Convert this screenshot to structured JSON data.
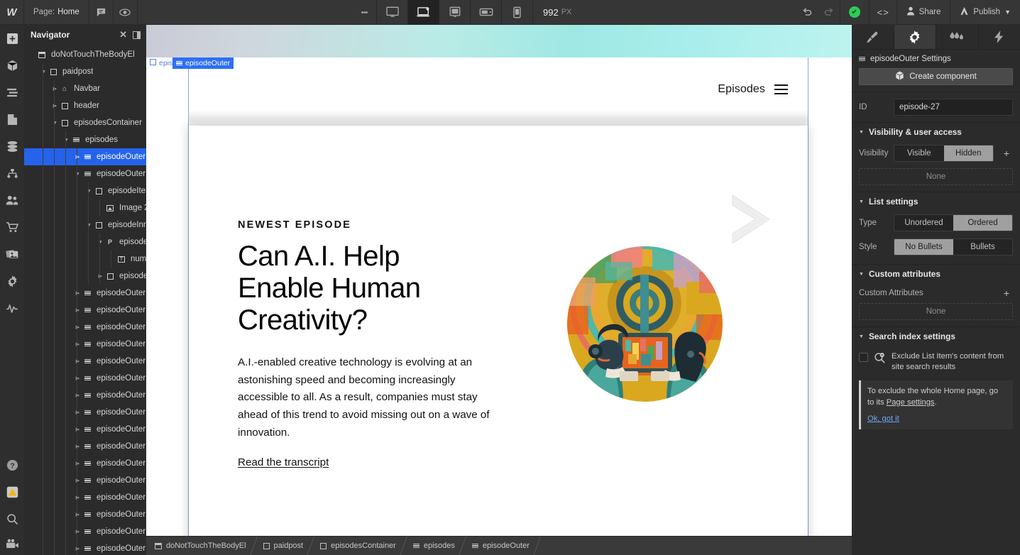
{
  "topbar": {
    "logo": "W",
    "page_label": "Page:",
    "page_name": "Home",
    "comment_icon": "comment-icon",
    "preview_icon": "eye-icon",
    "more_icon": "kebab-menu-icon",
    "devices": [
      {
        "name": "desktop-breakpoint",
        "icon": "monitor-icon",
        "active": false
      },
      {
        "name": "base-breakpoint",
        "icon": "laptop-star-icon",
        "active": true
      },
      {
        "name": "tablet-breakpoint",
        "icon": "tablet-icon",
        "active": false
      },
      {
        "name": "mobile-landscape-breakpoint",
        "icon": "mobile-landscape-icon",
        "active": false
      },
      {
        "name": "mobile-portrait-breakpoint",
        "icon": "mobile-icon",
        "active": false
      }
    ],
    "viewport_width": "992",
    "viewport_unit": "PX",
    "undo_icon": "undo-arrow-icon",
    "redo_icon": "redo-arrow-icon",
    "status_icon": "checkmark-icon",
    "status_color": "#2fcc56",
    "code_icon": "code-brackets-icon",
    "share_label": "Share",
    "share_icon": "person-icon",
    "publish_label": "Publish",
    "publish_icon": "rocket-icon",
    "publish_caret": "chevron-down-icon"
  },
  "rail": {
    "items": [
      {
        "name": "add-elements",
        "icon": "plus-square-icon"
      },
      {
        "name": "components",
        "icon": "cube-icon"
      },
      {
        "name": "style-manager",
        "icon": "sliders-icon"
      },
      {
        "name": "pages",
        "icon": "page-icon"
      },
      {
        "name": "cms",
        "icon": "database-icon"
      },
      {
        "name": "site-structure",
        "icon": "sitemap-icon"
      },
      {
        "name": "users",
        "icon": "users-icon"
      },
      {
        "name": "ecommerce",
        "icon": "cart-icon"
      },
      {
        "name": "assets",
        "icon": "images-icon"
      },
      {
        "name": "settings",
        "icon": "gear-icon"
      },
      {
        "name": "audit",
        "icon": "pulse-icon"
      }
    ],
    "bottom": [
      {
        "name": "help",
        "icon": "question-circle-icon"
      },
      {
        "name": "alerts",
        "icon": "warning-triangle-icon"
      },
      {
        "name": "search",
        "icon": "search-icon"
      },
      {
        "name": "video",
        "icon": "video-camera-icon"
      }
    ]
  },
  "navigator": {
    "title": "Navigator",
    "close_icon": "close-icon",
    "collapse_icon": "panel-toggle-icon",
    "tree": [
      {
        "label": "doNotTouchTheBodyEl",
        "depth": 0,
        "icon": "body-icon",
        "caret": "",
        "selected": false
      },
      {
        "label": "paidpost",
        "depth": 1,
        "icon": "div-icon",
        "caret": "down",
        "selected": false
      },
      {
        "label": "Navbar",
        "depth": 2,
        "icon": "navbar-icon",
        "caret": "right",
        "selected": false
      },
      {
        "label": "header",
        "depth": 2,
        "icon": "div-icon",
        "caret": "right",
        "selected": false
      },
      {
        "label": "episodesContainer",
        "depth": 2,
        "icon": "div-icon",
        "caret": "down",
        "selected": false
      },
      {
        "label": "episodes",
        "depth": 3,
        "icon": "list-icon",
        "caret": "down",
        "selected": false
      },
      {
        "label": "episodeOuter",
        "depth": 4,
        "icon": "list-item-icon",
        "caret": "right",
        "selected": true
      },
      {
        "label": "episodeOuter",
        "depth": 4,
        "icon": "list-item-icon",
        "caret": "down",
        "selected": false
      },
      {
        "label": "episodeItem",
        "depth": 5,
        "icon": "div-icon",
        "caret": "down",
        "selected": false
      },
      {
        "label": "Image 2",
        "depth": 6,
        "icon": "image-icon",
        "caret": "",
        "selected": false
      },
      {
        "label": "episodeInner",
        "depth": 5,
        "icon": "div-icon",
        "caret": "down",
        "selected": false
      },
      {
        "label": "episodeNum",
        "depth": 6,
        "icon": "paragraph-icon",
        "caret": "down",
        "selected": false
      },
      {
        "label": "number",
        "depth": 7,
        "icon": "text-icon",
        "caret": "",
        "selected": false
      },
      {
        "label": "episodeCon",
        "depth": 6,
        "icon": "div-icon",
        "caret": "right",
        "selected": false
      },
      {
        "label": "episodeOuter",
        "depth": 4,
        "icon": "list-item-icon",
        "caret": "right",
        "selected": false
      },
      {
        "label": "episodeOuter",
        "depth": 4,
        "icon": "list-item-icon",
        "caret": "right",
        "selected": false
      },
      {
        "label": "episodeOuter",
        "depth": 4,
        "icon": "list-item-icon",
        "caret": "right",
        "selected": false
      },
      {
        "label": "episodeOuter",
        "depth": 4,
        "icon": "list-item-icon",
        "caret": "right",
        "selected": false
      },
      {
        "label": "episodeOuter",
        "depth": 4,
        "icon": "list-item-icon",
        "caret": "right",
        "selected": false
      },
      {
        "label": "episodeOuter",
        "depth": 4,
        "icon": "list-item-icon",
        "caret": "right",
        "selected": false
      },
      {
        "label": "episodeOuter",
        "depth": 4,
        "icon": "list-item-icon",
        "caret": "right",
        "selected": false
      },
      {
        "label": "episodeOuter",
        "depth": 4,
        "icon": "list-item-icon",
        "caret": "right",
        "selected": false
      },
      {
        "label": "episodeOuter",
        "depth": 4,
        "icon": "list-item-icon",
        "caret": "right",
        "selected": false
      },
      {
        "label": "episodeOuter",
        "depth": 4,
        "icon": "list-item-icon",
        "caret": "right",
        "selected": false
      },
      {
        "label": "episodeOuter",
        "depth": 4,
        "icon": "list-item-icon",
        "caret": "right",
        "selected": false
      },
      {
        "label": "episodeOuter",
        "depth": 4,
        "icon": "list-item-icon",
        "caret": "right",
        "selected": false
      },
      {
        "label": "episodeOuter",
        "depth": 4,
        "icon": "list-item-icon",
        "caret": "right",
        "selected": false
      },
      {
        "label": "episodeOuter",
        "depth": 4,
        "icon": "list-item-icon",
        "caret": "right",
        "selected": false
      },
      {
        "label": "episodeOuter",
        "depth": 4,
        "icon": "list-item-icon",
        "caret": "right",
        "selected": false
      },
      {
        "label": "episodeOuter",
        "depth": 4,
        "icon": "list-item-icon",
        "caret": "right",
        "selected": false
      }
    ]
  },
  "canvas": {
    "badge_ghost": "episodes",
    "badge_active": "episodeOuter",
    "badge_active_color": "#2d6ff5",
    "site_nav_label": "Episodes",
    "menu_icon": "hamburger-menu-icon",
    "eyebrow": "NEWEST EPISODE",
    "headline": "Can A.I. Help Enable Human Creativity?",
    "body": "A.I.-enabled creative technology is evolving at an astonishing speed and becoming increasingly accessible to all. As a result, companies must stay ahead of this trend to avoid missing out on a wave of innovation.",
    "transcript_link": "Read the transcript",
    "chevron_icon": "chevron-right-decoration",
    "cover_icon": "episode-cover-image"
  },
  "breadcrumbs": [
    {
      "label": "doNotTouchTheBodyEl",
      "icon": "body-icon"
    },
    {
      "label": "paidpost",
      "icon": "div-icon"
    },
    {
      "label": "episodesContainer",
      "icon": "div-icon"
    },
    {
      "label": "episodes",
      "icon": "list-icon"
    },
    {
      "label": "episodeOuter",
      "icon": "list-item-icon"
    }
  ],
  "settings": {
    "tabs": [
      {
        "name": "style-panel",
        "icon": "paintbrush-icon",
        "active": false
      },
      {
        "name": "settings-panel",
        "icon": "gear-icon",
        "active": true
      },
      {
        "name": "interactions-panel",
        "icon": "droplets-icon",
        "active": false
      },
      {
        "name": "effects-panel",
        "icon": "lightning-icon",
        "active": false
      }
    ],
    "title": "episodeOuter Settings",
    "title_icon": "list-item-icon",
    "create_component_label": "Create component",
    "create_component_icon": "component-cube-icon",
    "id_label": "ID",
    "id_value": "episode-27",
    "visibility_section": "Visibility & user access",
    "visibility_label": "Visibility",
    "visibility_options": [
      "Visible",
      "Hidden"
    ],
    "visibility_selected": "Hidden",
    "visibility_add_icon": "plus-icon",
    "visibility_none": "None",
    "list_section": "List settings",
    "type_label": "Type",
    "type_options": [
      "Unordered",
      "Ordered"
    ],
    "type_selected": "Ordered",
    "style_label": "Style",
    "style_options": [
      "No Bullets",
      "Bullets"
    ],
    "style_selected": "No Bullets",
    "custom_section": "Custom attributes",
    "custom_attrs_label": "Custom Attributes",
    "custom_attrs_add_icon": "plus-icon",
    "custom_attrs_none": "None",
    "search_section": "Search index settings",
    "exclude_icon": "search-minus-icon",
    "exclude_label": "Exclude List Item's content from site search results",
    "tip_text_1": "To exclude the whole Home page, go to its ",
    "tip_link": "Page settings",
    "tip_text_2": ".",
    "tip_ok": "Ok, got it"
  }
}
